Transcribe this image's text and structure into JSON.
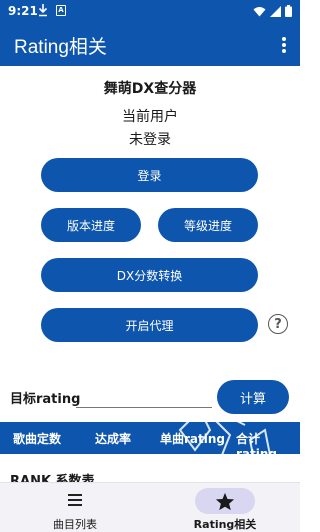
{
  "status": {
    "time": "9:21"
  },
  "appbar": {
    "title": "Rating相关"
  },
  "main": {
    "heading": "舞萌DX查分器",
    "user_label": "当前用户",
    "user_value": "未登录",
    "login_label": "登录",
    "version_progress_label": "版本进度",
    "level_progress_label": "等级进度",
    "dx_score_convert_label": "DX分数转换",
    "enable_proxy_label": "开启代理",
    "help_label": "?"
  },
  "target": {
    "label": "目标rating",
    "value": "",
    "calc_label": "计算"
  },
  "table": {
    "headers": [
      "歌曲定数",
      "达成率",
      "单曲rating",
      "合计rating"
    ]
  },
  "rank_title": "RANK 系数表",
  "nav": {
    "items": [
      {
        "label": "曲目列表"
      },
      {
        "label": "Rating相关"
      }
    ]
  },
  "colors": {
    "primary": "#0d55ad",
    "nav_bg": "#f3f3f7",
    "nav_pill": "#d8d6f0"
  },
  "icons": {
    "menu": "more-vert-icon",
    "song_list": "list-icon",
    "rating": "star-icon",
    "help": "help-circle-icon"
  }
}
